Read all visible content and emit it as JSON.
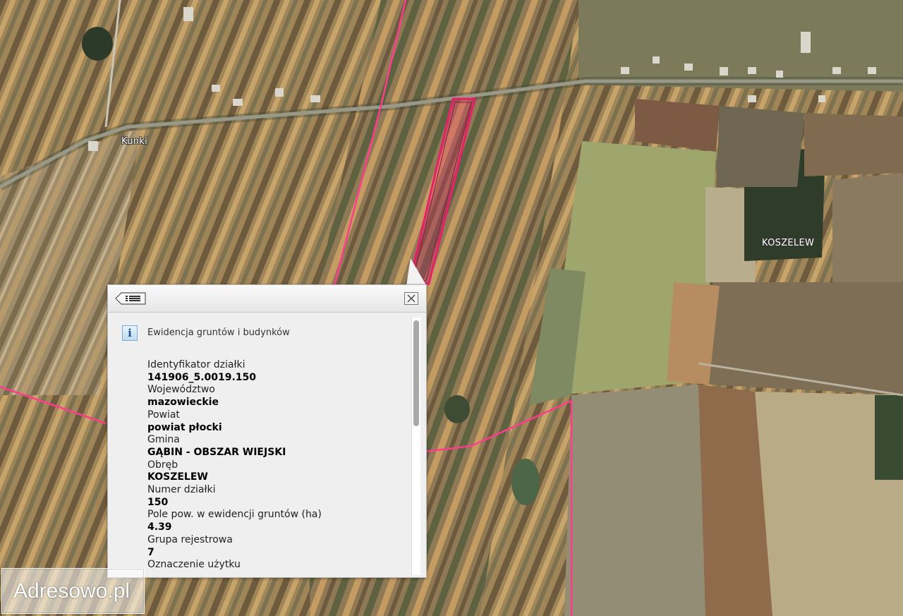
{
  "map": {
    "places": {
      "kunki": "Kunki",
      "koszelew": "KOSZELEW"
    },
    "colors": {
      "parcel_outline": "#e8206a",
      "boundary_line": "#ff3c8c"
    }
  },
  "popup": {
    "back_icon": "list-back-icon",
    "close_icon": "close-icon",
    "info_icon_label": "i",
    "section_title": "Ewidencja gruntów i budynków",
    "fields": [
      {
        "label": "Identyfikator działki",
        "value": "141906_5.0019.150"
      },
      {
        "label": "Województwo",
        "value": "mazowieckie"
      },
      {
        "label": "Powiat",
        "value": "powiat płocki"
      },
      {
        "label": "Gmina",
        "value": "GĄBIN - OBSZAR WIEJSKI"
      },
      {
        "label": "Obręb",
        "value": "KOSZELEW"
      },
      {
        "label": "Numer działki",
        "value": "150"
      },
      {
        "label": "Pole pow. w ewidencji gruntów (ha)",
        "value": "4.39"
      },
      {
        "label": "Grupa rejestrowa",
        "value": "7"
      },
      {
        "label": "Oznaczenie użytku",
        "value": ""
      }
    ]
  },
  "watermark": "Adresowo.pl"
}
